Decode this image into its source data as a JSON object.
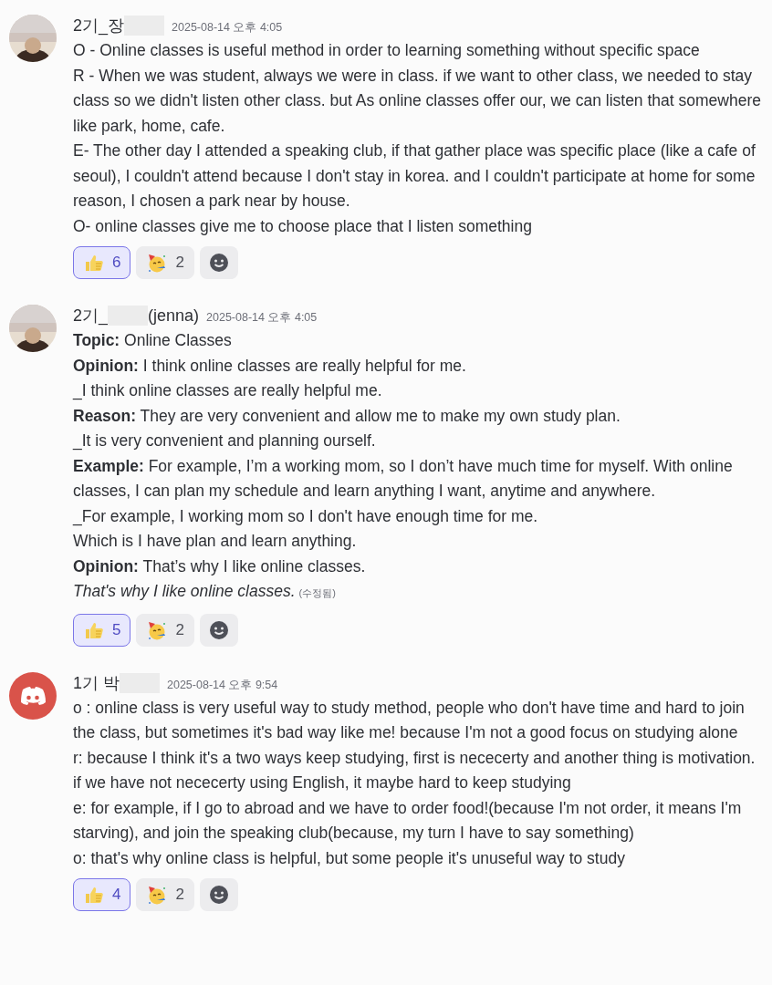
{
  "messages": [
    {
      "author": "2기_장",
      "avatar": {
        "kind": "picture"
      },
      "timestamp": "2025-08-14 오후 4:05",
      "lines": [
        {
          "text": "O - Online classes is useful method in order to learning something without specific space"
        },
        {
          "text": "R - When we was student, always we were in class. if we want to other class, we needed to stay class so we didn't listen other class. but As online classes offer our, we can listen that somewhere like park, home, cafe."
        },
        {
          "text": "E- The other day I attended a speaking club, if that gather place was specific place (like a cafe of seoul), I couldn't attend because I don't stay in korea. and I couldn't participate at home for some reason, I chosen a park near by house."
        },
        {
          "text": "O- online classes give me to choose place that I listen something"
        }
      ],
      "reactions": [
        {
          "kind": "thumbs",
          "count": "6",
          "selected": true
        },
        {
          "kind": "party",
          "count": "2",
          "selected": false
        }
      ]
    },
    {
      "author": "2기_",
      "author_suffix": "(jenna)",
      "avatar": {
        "kind": "picture"
      },
      "timestamp": "2025-08-14 오후 4:05",
      "lines": [
        {
          "text": "**Topic:** Online Classes"
        },
        {
          "text": "**Opinion:** I think online classes are really helpful for me."
        },
        {
          "text": "_I think online classes are really helpful me."
        },
        {
          "text": "**Reason:** They are very convenient and allow me to make my own study plan."
        },
        {
          "text": "_It is very convenient and planning ourself."
        },
        {
          "text": "**Example:** For example, I’m a working mom, so I don’t have much time for myself. With online classes, I can plan my schedule and learn anything I want, anytime and anywhere."
        },
        {
          "text": "_For example, I working mom so I don't have enough time for me."
        },
        {
          "text": "Which is I have plan and learn anything."
        },
        {
          "text": "**Opinion:** That’s why I like online classes."
        },
        {
          "text": "That's why I like online classes.",
          "italic": true,
          "edited": "(수정됨)"
        }
      ],
      "reactions": [
        {
          "kind": "thumbs",
          "count": "5",
          "selected": true
        },
        {
          "kind": "party",
          "count": "2",
          "selected": false
        }
      ]
    },
    {
      "author": "1기 박",
      "avatar": {
        "kind": "logo"
      },
      "timestamp": "2025-08-14 오후 9:54",
      "lines": [
        {
          "text": "o :  online class is very useful way to study method, people who don't have time and hard to join the class, but sometimes it's bad way like me! because I'm not a good focus on studying alone"
        },
        {
          "text": "r: because I think it's a two ways keep studying, first is nececerty and another thing is motivation. if we have not nececerty using English, it maybe hard to keep studying"
        },
        {
          "text": "e: for example, if I go to abroad and we have to order food!(because I'm not order, it means I'm starving), and join the speaking club(because, my turn I have to say something)"
        },
        {
          "text": "o: that's why online class is helpful, but some people it's unuseful way to study"
        }
      ],
      "reactions": [
        {
          "kind": "thumbs",
          "count": "4",
          "selected": true
        },
        {
          "kind": "party",
          "count": "2",
          "selected": false
        }
      ]
    }
  ]
}
